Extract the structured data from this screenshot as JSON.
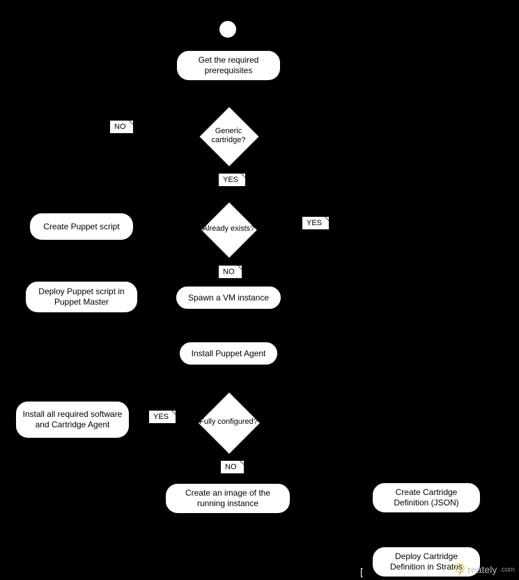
{
  "start": "",
  "boxes": {
    "prereq": "Get the required prerequisites",
    "createPuppet": "Create Puppet script",
    "deployPuppet": "Deploy Puppet script in Puppet Master",
    "spawnVm": "Spawn a VM instance",
    "installAgent": "Install Puppet Agent",
    "installAll": "Install all required software and Cartridge Agent",
    "createImage": "Create an image of the running instance",
    "createDef": "Create Cartridge Definition (JSON)",
    "deployDef": "Deploy Cartridge Definition in Stratos"
  },
  "decisions": {
    "generic": "Generic cartridge?",
    "exists": "Already exists?",
    "configured": "Fully configured?"
  },
  "labels": {
    "yes": "YES",
    "no": "NO"
  },
  "watermark": {
    "text": "reately",
    "suffix": ".com"
  }
}
